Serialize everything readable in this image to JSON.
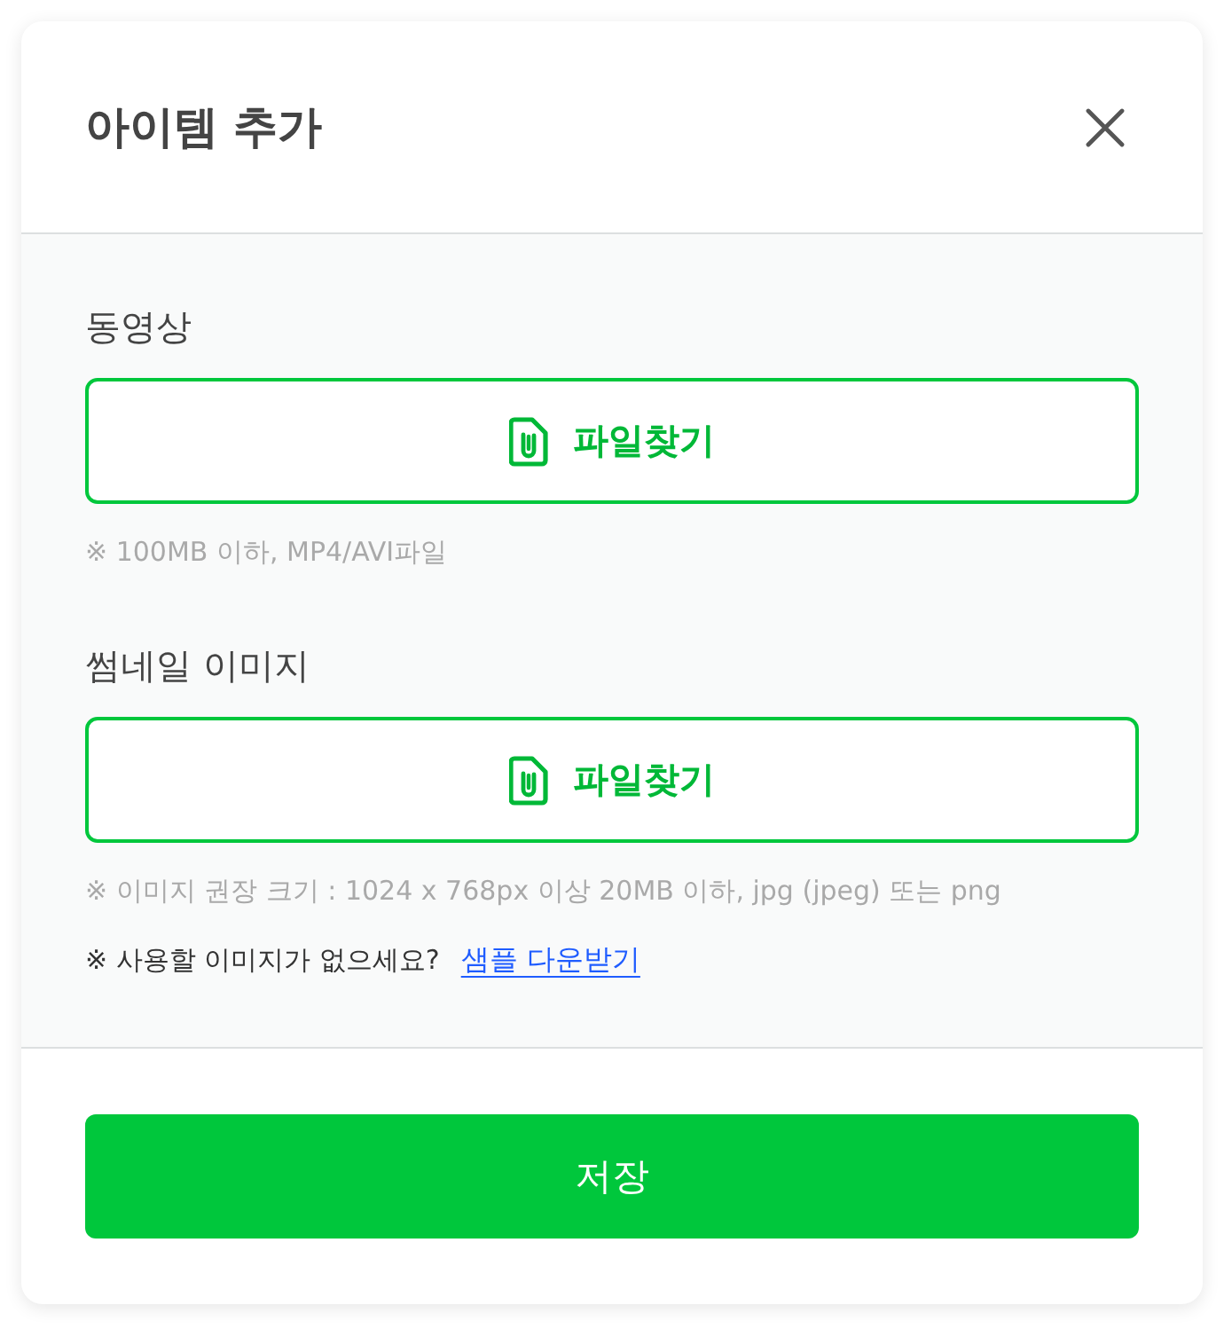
{
  "dialog": {
    "title": "아이템 추가"
  },
  "fields": [
    {
      "label": "동영상",
      "button": "파일찾기",
      "notes": [
        {
          "kind": "hint",
          "text": "※ 100MB 이하, MP4/AVI파일"
        }
      ]
    },
    {
      "label": "썸네일 이미지",
      "button": "파일찾기",
      "notes": [
        {
          "kind": "hint",
          "text": "※ 이미지 권장 크기 : 1024 x 768px 이상 20MB 이하, jpg (jpeg) 또는 png"
        },
        {
          "kind": "prompt",
          "text": "※ 사용할 이미지가 없으세요?",
          "link": "샘플 다운받기"
        }
      ]
    }
  ],
  "footer": {
    "save_button": "저장"
  }
}
